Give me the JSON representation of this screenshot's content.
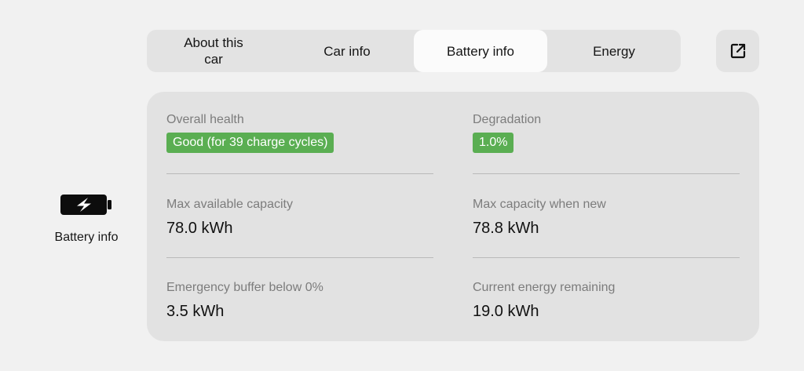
{
  "tabs": [
    {
      "label": "About this car"
    },
    {
      "label": "Car info"
    },
    {
      "label": "Battery info",
      "active": true
    },
    {
      "label": "Energy"
    }
  ],
  "external_link_icon": "open-external-icon",
  "nav": {
    "icon": "battery-charging-icon",
    "label": "Battery info"
  },
  "battery": {
    "overall_health_label": "Overall health",
    "overall_health_value": "Good (for 39 charge cycles)",
    "degradation_label": "Degradation",
    "degradation_value": "1.0%",
    "max_available_capacity_label": "Max available capacity",
    "max_available_capacity_value": "78.0 kWh",
    "max_capacity_new_label": "Max capacity when new",
    "max_capacity_new_value": "78.8 kWh",
    "emergency_buffer_label": "Emergency buffer below 0%",
    "emergency_buffer_value": "3.5 kWh",
    "current_energy_label": "Current energy remaining",
    "current_energy_value": "19.0 kWh"
  },
  "colors": {
    "badge_green": "#5aae52",
    "active_tab": "#fbfbfb",
    "background": "#f1f1f1"
  }
}
